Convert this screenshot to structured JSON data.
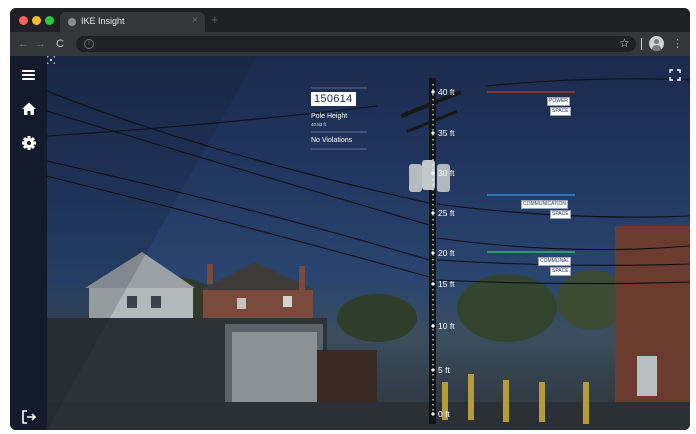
{
  "browser": {
    "tab_title": "IKE Insight",
    "tab_close": "×",
    "new_tab": "+",
    "back": "←",
    "forward": "→",
    "reload": "C",
    "info": "i",
    "star": "☆",
    "menu": "⋮"
  },
  "sidebar": {
    "items": [
      {
        "icon": "hamburger-menu-icon"
      },
      {
        "icon": "home-icon"
      },
      {
        "icon": "gear-icon"
      },
      {
        "icon": "logout-icon"
      }
    ]
  },
  "pole": {
    "id": "150614",
    "height_label": "Pole Height",
    "height_value": "40.83 ft",
    "violations": "No Violations"
  },
  "height_scale": [
    "40 ft",
    "35 ft",
    "30 ft",
    "25 ft",
    "20 ft",
    "15 ft",
    "10 ft",
    "5 ft",
    "0 ft"
  ],
  "spaces": {
    "power": {
      "line1": "POWER",
      "line2": "SPACE",
      "color": "#c0392b"
    },
    "communication": {
      "line1": "COMMUNICATION",
      "line2": "SPACE",
      "color": "#3498db"
    },
    "communal": {
      "line1": "COMMUNAL",
      "line2": "SPACE",
      "color": "#2ecc71"
    }
  },
  "colors": {
    "sidebar": "#121a2c",
    "accent": "#1b2a4c"
  }
}
